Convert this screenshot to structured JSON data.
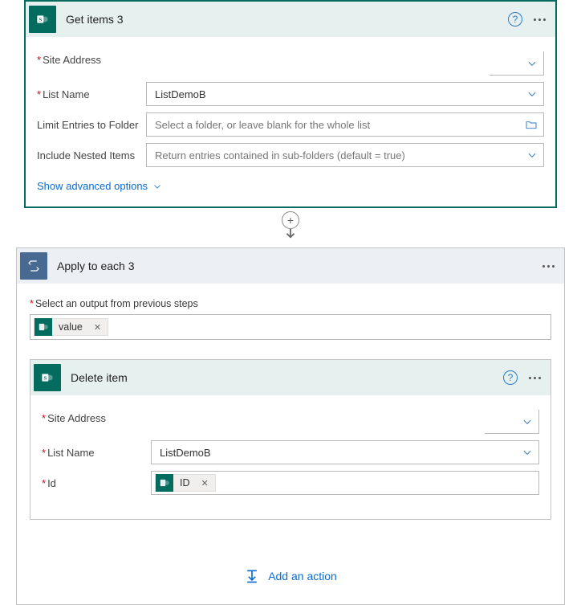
{
  "getItems": {
    "title": "Get items 3",
    "fields": {
      "siteAddress": {
        "label": "Site Address",
        "value": ""
      },
      "listName": {
        "label": "List Name",
        "value": "ListDemoB"
      },
      "limitFolder": {
        "label": "Limit Entries to Folder",
        "placeholder": "Select a folder, or leave blank for the whole list"
      },
      "includeNested": {
        "label": "Include Nested Items",
        "value": "Return entries contained in sub-folders (default = true)"
      }
    },
    "advancedLink": "Show advanced options"
  },
  "applyEach": {
    "title": "Apply to each 3",
    "selectLabel": "Select an output from previous steps",
    "token": "value"
  },
  "deleteItem": {
    "title": "Delete item",
    "fields": {
      "siteAddress": {
        "label": "Site Address",
        "value": ""
      },
      "listName": {
        "label": "List Name",
        "value": "ListDemoB"
      },
      "id": {
        "label": "Id",
        "token": "ID"
      }
    }
  },
  "addAction": "Add an action"
}
